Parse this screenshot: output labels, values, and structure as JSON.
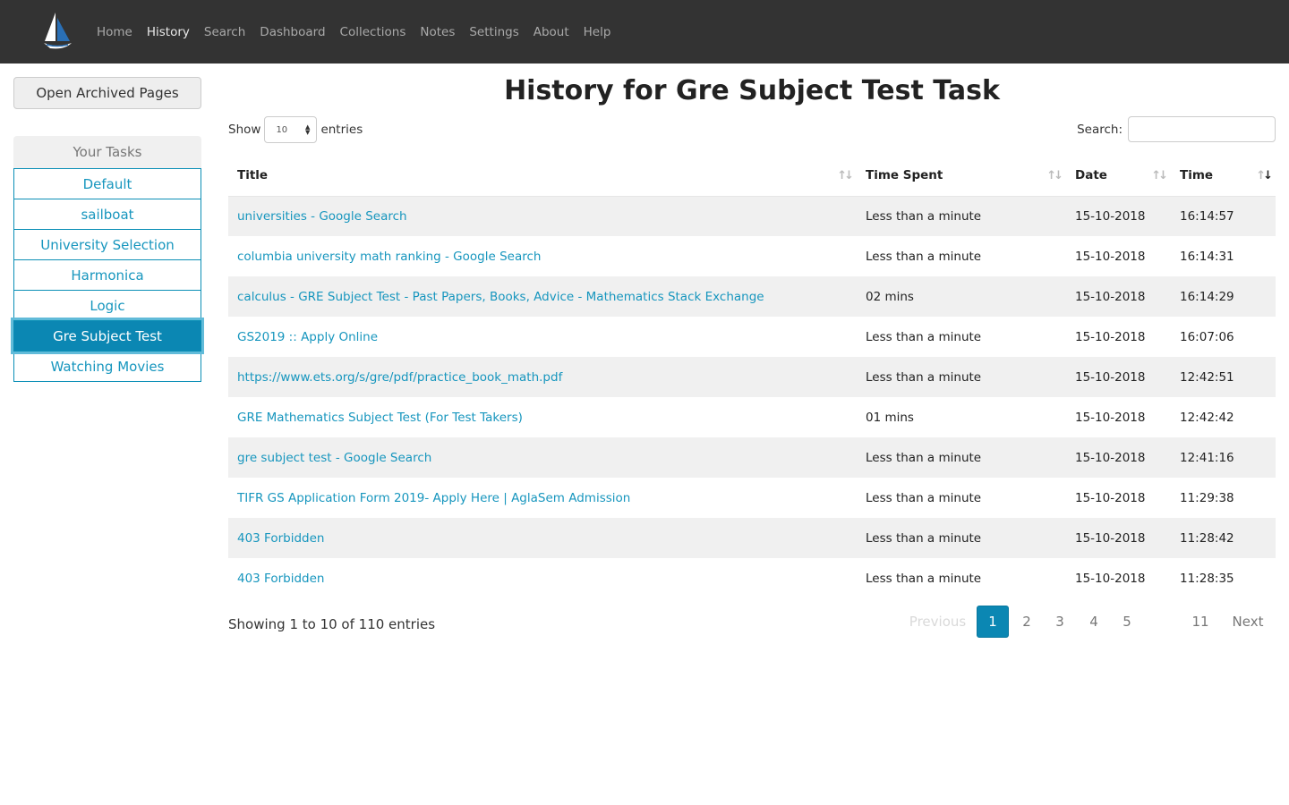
{
  "nav": {
    "items": [
      "Home",
      "History",
      "Search",
      "Dashboard",
      "Collections",
      "Notes",
      "Settings",
      "About",
      "Help"
    ],
    "active": "History"
  },
  "sidebar": {
    "archived_button": "Open Archived Pages",
    "tasks_header": "Your Tasks",
    "tasks": [
      "Default",
      "sailboat",
      "University Selection",
      "Harmonica",
      "Logic",
      "Gre Subject Test",
      "Watching Movies"
    ],
    "active_task": "Gre Subject Test"
  },
  "main": {
    "title": "History for Gre Subject Test Task",
    "show_label": "Show",
    "entries_value": "10",
    "entries_label": "entries",
    "search_label": "Search:",
    "columns": [
      "Title",
      "Time Spent",
      "Date",
      "Time"
    ],
    "rows": [
      [
        "universities - Google Search",
        "Less than a minute",
        "15-10-2018",
        "16:14:57"
      ],
      [
        "columbia university math ranking - Google Search",
        "Less than a minute",
        "15-10-2018",
        "16:14:31"
      ],
      [
        "calculus - GRE Subject Test - Past Papers, Books, Advice - Mathematics Stack Exchange",
        "02 mins",
        "15-10-2018",
        "16:14:29"
      ],
      [
        "GS2019 :: Apply Online",
        "Less than a minute",
        "15-10-2018",
        "16:07:06"
      ],
      [
        "https://www.ets.org/s/gre/pdf/practice_book_math.pdf",
        "Less than a minute",
        "15-10-2018",
        "12:42:51"
      ],
      [
        "GRE Mathematics Subject Test (For Test Takers)",
        "01 mins",
        "15-10-2018",
        "12:42:42"
      ],
      [
        "gre subject test - Google Search",
        "Less than a minute",
        "15-10-2018",
        "12:41:16"
      ],
      [
        "TIFR GS Application Form 2019- Apply Here | AglaSem Admission",
        "Less than a minute",
        "15-10-2018",
        "11:29:38"
      ],
      [
        "403 Forbidden",
        "Less than a minute",
        "15-10-2018",
        "11:28:42"
      ],
      [
        "403 Forbidden",
        "Less than a minute",
        "15-10-2018",
        "11:28:35"
      ]
    ],
    "info": "Showing 1 to 10 of 110 entries",
    "pagination": {
      "previous": "Previous",
      "pages": [
        "1",
        "2",
        "3",
        "4",
        "5",
        "11"
      ],
      "ellipsis": "…",
      "next": "Next",
      "current": "1"
    }
  }
}
